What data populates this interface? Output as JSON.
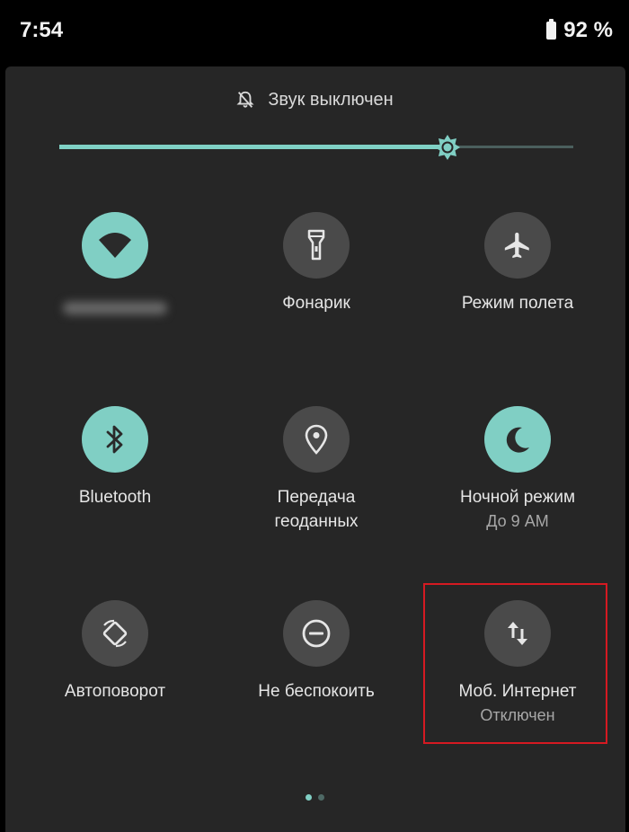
{
  "status_bar": {
    "time": "7:54",
    "battery": "92 %",
    "battery_icon": "battery-icon"
  },
  "sound": {
    "icon": "bell-off-icon",
    "label": "Звук выключен"
  },
  "brightness": {
    "level_percent": 75,
    "thumb_icon": "brightness-icon"
  },
  "tiles": [
    {
      "label": "",
      "sub": "",
      "icon": "wifi-icon",
      "active": true,
      "label_blurred": true
    },
    {
      "label": "Фонарик",
      "sub": "",
      "icon": "flashlight-icon",
      "active": false
    },
    {
      "label": "Режим полета",
      "sub": "",
      "icon": "airplane-icon",
      "active": false
    },
    {
      "label": "Bluetooth",
      "sub": "",
      "icon": "bluetooth-icon",
      "active": true
    },
    {
      "label": "Передача\nгеоданных",
      "sub": "",
      "icon": "location-icon",
      "active": false
    },
    {
      "label": "Ночной режим",
      "sub": "До 9 AM",
      "icon": "moon-icon",
      "active": true
    },
    {
      "label": "Автоповорот",
      "sub": "",
      "icon": "autorotate-icon",
      "active": false
    },
    {
      "label": "Не беспокоить",
      "sub": "",
      "icon": "do-not-disturb-icon",
      "active": false
    },
    {
      "label": "Моб. Интернет",
      "sub": "Отключен",
      "icon": "mobile-data-icon",
      "active": false
    }
  ],
  "page_indicator": {
    "current": 1,
    "total": 2
  },
  "colors": {
    "accent": "#80cfc4",
    "panel": "#262626",
    "inactive_tile": "#4a4a4a",
    "highlight": "#d51a22"
  }
}
